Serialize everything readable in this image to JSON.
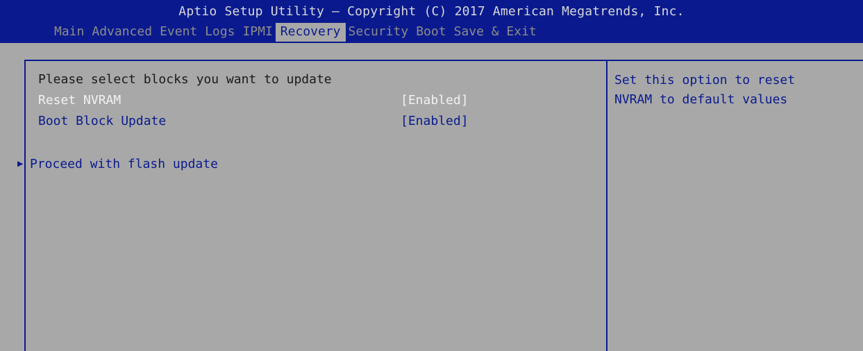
{
  "header": {
    "title": "Aptio Setup Utility – Copyright (C) 2017 American Megatrends, Inc."
  },
  "menu": {
    "tabs": [
      {
        "label": "Main"
      },
      {
        "label": "Advanced"
      },
      {
        "label": "Event Logs"
      },
      {
        "label": "IPMI"
      },
      {
        "label": "Recovery"
      },
      {
        "label": "Security"
      },
      {
        "label": "Boot"
      },
      {
        "label": "Save & Exit"
      }
    ],
    "active": "Recovery"
  },
  "main": {
    "intro": "Please select blocks you want to update",
    "settings": [
      {
        "label": "Reset NVRAM",
        "value": "[Enabled]"
      },
      {
        "label": "Boot Block Update",
        "value": "[Enabled]"
      }
    ],
    "submenu": {
      "arrow": "▶",
      "label": "Proceed with flash update"
    }
  },
  "help": {
    "text": "Set this option to reset\nNVRAM to default values"
  },
  "colors": {
    "header_bg": "#0a1a8e",
    "body_bg": "#a8a8a8",
    "highlight": "#f2f2f2",
    "accent": "#0a1a8e"
  }
}
